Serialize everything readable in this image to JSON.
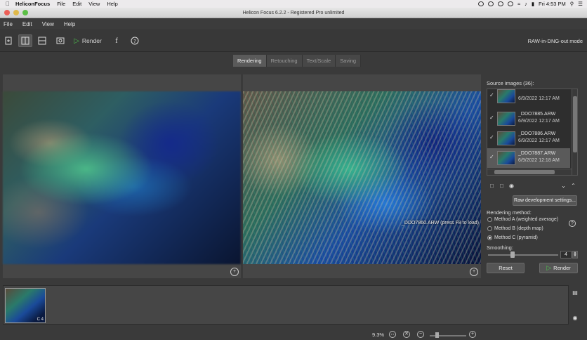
{
  "menubar": {
    "app_name": "HeliconFocus",
    "items": [
      "File",
      "Edit",
      "View",
      "Help"
    ],
    "clock": "Fri 4:53 PM"
  },
  "window": {
    "title": "Helicon Focus 6.2.2 - Registered Pro unlimited"
  },
  "app_menu": {
    "items": [
      "File",
      "Edit",
      "View",
      "Help"
    ]
  },
  "toolbar": {
    "render_label": "Render",
    "mode_label": "RAW-in-DNG-out mode"
  },
  "tabs": [
    {
      "label": "Rendering",
      "active": true
    },
    {
      "label": "Retouching",
      "active": false
    },
    {
      "label": "Text/Scale",
      "active": false
    },
    {
      "label": "Saving",
      "active": false
    }
  ],
  "preview": {
    "caption": "_DDO7860.ARW (press F8 to load)"
  },
  "sources": {
    "label": "Source images (36):",
    "items": [
      {
        "name": "",
        "date": "6/9/2022 12:17 AM",
        "checked": true
      },
      {
        "name": "_DDO7885.ARW",
        "date": "6/9/2022 12:17 AM",
        "checked": true
      },
      {
        "name": "_DDO7886.ARW",
        "date": "6/9/2022 12:17 AM",
        "checked": true
      },
      {
        "name": "_DDO7887.ARW",
        "date": "6/9/2022 12:18 AM",
        "checked": true
      }
    ]
  },
  "settings": {
    "raw_button": "Raw development settings...",
    "rendering_method_label": "Rendering method:",
    "methods": [
      {
        "label": "Method A (weighted average)",
        "selected": false
      },
      {
        "label": "Method B (depth map)",
        "selected": false
      },
      {
        "label": "Method C (pyramid)",
        "selected": true
      }
    ],
    "smoothing_label": "Smoothing:",
    "smoothing_value": "4",
    "reset_label": "Reset",
    "render_label": "Render"
  },
  "filmstrip": {
    "tag": "C 4"
  },
  "statusbar": {
    "zoom": "9.3%"
  },
  "colors": {
    "accent_green": "#4ec04e",
    "panel_bg": "#464646"
  }
}
